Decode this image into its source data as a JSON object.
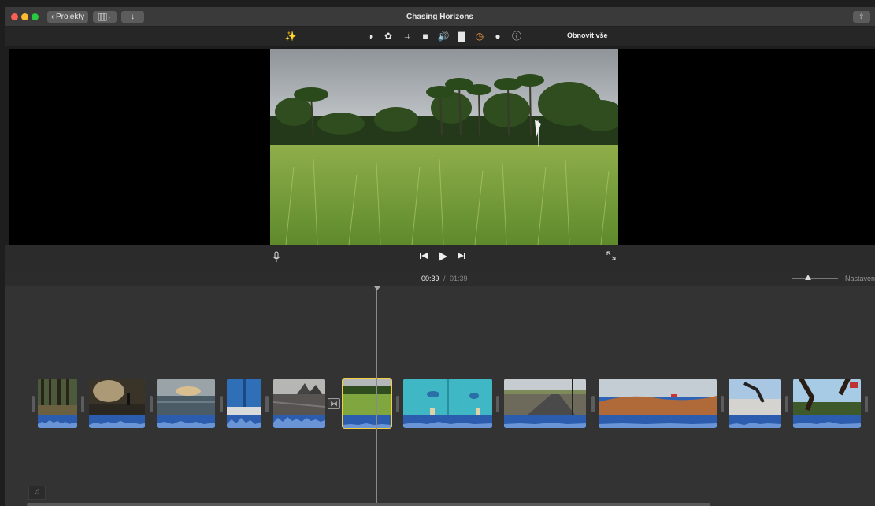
{
  "window": {
    "title": "Chasing Horizons",
    "projects_label": "Projekty",
    "media_icon": "film-music-icon",
    "import_icon": "download-arrow-icon",
    "share_icon": "share-icon"
  },
  "adjustments": {
    "icons": [
      "magic-wand-icon",
      "color-balance-icon",
      "color-correction-icon",
      "crop-icon",
      "stabilization-icon",
      "volume-icon",
      "equalizer-icon",
      "speed-icon",
      "clip-filter-icon",
      "info-icon"
    ],
    "reset_label": "Obnovit vše",
    "active_color": "#3b8ff3",
    "accent_color": "#f09a3e"
  },
  "viewer": {
    "controls": {
      "voiceover_icon": "microphone-icon",
      "prev_icon": "skip-back-icon",
      "play_icon": "play-icon",
      "next_icon": "skip-forward-icon",
      "fullscreen_icon": "fullscreen-icon"
    }
  },
  "timeline": {
    "current_time": "00:39",
    "separator": "/",
    "total_time": "01:39",
    "settings_label": "Nastaven",
    "selection_color": "#f4d03f",
    "clips": [
      {
        "name": "forest"
      },
      {
        "name": "rider-sunlight"
      },
      {
        "name": "ocean-sunset"
      },
      {
        "name": "blue-door"
      },
      {
        "name": "rocky-beach"
      },
      {
        "name": "rice-field",
        "selected": true
      },
      {
        "name": "pool-swimmer"
      },
      {
        "name": "road-trip"
      },
      {
        "name": "desert-dunes"
      },
      {
        "name": "skateboard"
      },
      {
        "name": "running-legs"
      }
    ],
    "transition_icon": "cross-dissolve-icon",
    "music_icon": "music-note-icon"
  }
}
